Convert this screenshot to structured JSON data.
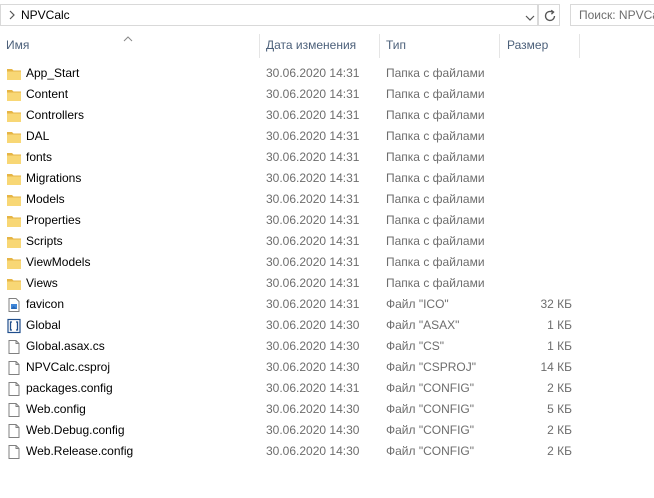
{
  "address": {
    "path": "NPVCalc"
  },
  "search": {
    "placeholder": "Поиск: NPVCalc"
  },
  "columns": {
    "name": "Имя",
    "date": "Дата изменения",
    "type": "Тип",
    "size": "Размер"
  },
  "files": [
    {
      "icon": "folder-icon",
      "name": "App_Start",
      "date": "30.06.2020 14:31",
      "type": "Папка с файлами",
      "size": ""
    },
    {
      "icon": "folder-icon",
      "name": "Content",
      "date": "30.06.2020 14:31",
      "type": "Папка с файлами",
      "size": ""
    },
    {
      "icon": "folder-icon",
      "name": "Controllers",
      "date": "30.06.2020 14:31",
      "type": "Папка с файлами",
      "size": ""
    },
    {
      "icon": "folder-icon",
      "name": "DAL",
      "date": "30.06.2020 14:31",
      "type": "Папка с файлами",
      "size": ""
    },
    {
      "icon": "folder-icon",
      "name": "fonts",
      "date": "30.06.2020 14:31",
      "type": "Папка с файлами",
      "size": ""
    },
    {
      "icon": "folder-icon",
      "name": "Migrations",
      "date": "30.06.2020 14:31",
      "type": "Папка с файлами",
      "size": ""
    },
    {
      "icon": "folder-icon",
      "name": "Models",
      "date": "30.06.2020 14:31",
      "type": "Папка с файлами",
      "size": ""
    },
    {
      "icon": "folder-icon",
      "name": "Properties",
      "date": "30.06.2020 14:31",
      "type": "Папка с файлами",
      "size": ""
    },
    {
      "icon": "folder-icon",
      "name": "Scripts",
      "date": "30.06.2020 14:31",
      "type": "Папка с файлами",
      "size": ""
    },
    {
      "icon": "folder-icon",
      "name": "ViewModels",
      "date": "30.06.2020 14:31",
      "type": "Папка с файлами",
      "size": ""
    },
    {
      "icon": "folder-icon",
      "name": "Views",
      "date": "30.06.2020 14:31",
      "type": "Папка с файлами",
      "size": ""
    },
    {
      "icon": "image-file-icon",
      "name": "favicon",
      "date": "30.06.2020 14:31",
      "type": "Файл \"ICO\"",
      "size": "32 КБ"
    },
    {
      "icon": "asax-file-icon",
      "name": "Global",
      "date": "30.06.2020 14:30",
      "type": "Файл \"ASAX\"",
      "size": "1 КБ"
    },
    {
      "icon": "file-icon",
      "name": "Global.asax.cs",
      "date": "30.06.2020 14:30",
      "type": "Файл \"CS\"",
      "size": "1 КБ"
    },
    {
      "icon": "file-icon",
      "name": "NPVCalc.csproj",
      "date": "30.06.2020 14:30",
      "type": "Файл \"CSPROJ\"",
      "size": "14 КБ"
    },
    {
      "icon": "file-icon",
      "name": "packages.config",
      "date": "30.06.2020 14:31",
      "type": "Файл \"CONFIG\"",
      "size": "2 КБ"
    },
    {
      "icon": "file-icon",
      "name": "Web.config",
      "date": "30.06.2020 14:30",
      "type": "Файл \"CONFIG\"",
      "size": "5 КБ"
    },
    {
      "icon": "file-icon",
      "name": "Web.Debug.config",
      "date": "30.06.2020 14:30",
      "type": "Файл \"CONFIG\"",
      "size": "2 КБ"
    },
    {
      "icon": "file-icon",
      "name": "Web.Release.config",
      "date": "30.06.2020 14:30",
      "type": "Файл \"CONFIG\"",
      "size": "2 КБ"
    }
  ],
  "colors": {
    "folder": "#f8d775",
    "folder_dark": "#e6b545",
    "header_text": "#4c607a",
    "secondary_text": "#6d6d6d"
  }
}
